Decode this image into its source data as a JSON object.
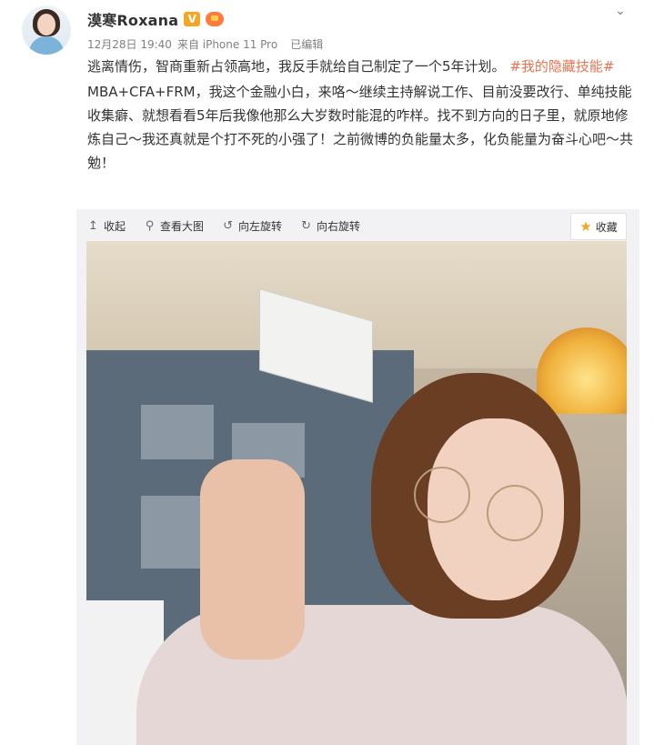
{
  "user": {
    "name": "漠寒Roxana",
    "verified_badge": "V"
  },
  "meta": {
    "time": "12月28日 19:40",
    "source": "来自 iPhone 11 Pro",
    "edited": "已编辑"
  },
  "post": {
    "line1_text": "逃离情伤，智商重新占领高地，我反手就给自己制定了一个5年计划。",
    "hashtag": "#我的隐藏技能#",
    "paragraph2": "MBA+CFA+FRM，我这个金融小白，来咯～继续主持解说工作、目前没要改行、单纯技能收集癖、就想看看5年后我像他那么大岁数时能混的咋样。找不到方向的日子里，就原地修炼自己～我还真就是个打不死的小强了！之前微博的负能量太多，化负能量为奋斗心吧～共勉！"
  },
  "toolbar": {
    "collapse": "收起",
    "view_large": "查看大图",
    "rotate_left": "向左旋转",
    "rotate_right": "向右旋转"
  },
  "favorite": {
    "label": "收藏"
  },
  "colors": {
    "hashtag": "#eb7350",
    "verified": "#f5a623",
    "meta_text": "#808080",
    "media_bg": "#f2f2f5"
  },
  "icons": [
    "chevron-down-icon",
    "collapse-icon",
    "search-icon",
    "rotate-left-icon",
    "rotate-right-icon",
    "star-icon",
    "vip-icon"
  ]
}
